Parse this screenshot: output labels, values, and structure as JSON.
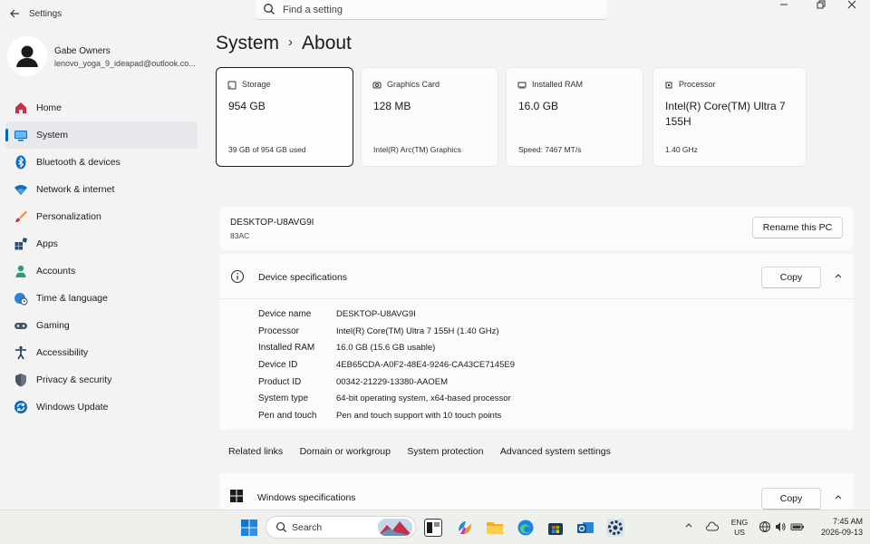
{
  "window": {
    "title": "Settings"
  },
  "search": {
    "placeholder": "Find a setting"
  },
  "user": {
    "name": "Gabe Owners",
    "email": "lenovo_yoga_9_ideapad@outlook.co..."
  },
  "sidebar": {
    "items": [
      {
        "label": "Home",
        "icon": "home-icon"
      },
      {
        "label": "System",
        "icon": "monitor-icon",
        "active": true
      },
      {
        "label": "Bluetooth & devices",
        "icon": "bluetooth-icon"
      },
      {
        "label": "Network & internet",
        "icon": "wifi-icon"
      },
      {
        "label": "Personalization",
        "icon": "brush-icon"
      },
      {
        "label": "Apps",
        "icon": "apps-icon"
      },
      {
        "label": "Accounts",
        "icon": "person-icon"
      },
      {
        "label": "Time & language",
        "icon": "globe-clock-icon"
      },
      {
        "label": "Gaming",
        "icon": "gamepad-icon"
      },
      {
        "label": "Accessibility",
        "icon": "accessibility-icon"
      },
      {
        "label": "Privacy & security",
        "icon": "shield-icon"
      },
      {
        "label": "Windows Update",
        "icon": "update-icon"
      }
    ]
  },
  "breadcrumb": {
    "parent": "System",
    "separator": "›",
    "current": "About"
  },
  "cards": [
    {
      "title": "Storage",
      "value": "954 GB",
      "sub": "39 GB of 954 GB used"
    },
    {
      "title": "Graphics Card",
      "value": "128 MB",
      "sub": "Intel(R) Arc(TM) Graphics"
    },
    {
      "title": "Installed RAM",
      "value": "16.0 GB",
      "sub": "Speed: 7467 MT/s"
    },
    {
      "title": "Processor",
      "value": "Intel(R) Core(TM) Ultra 7 155H",
      "sub": "1.40 GHz"
    }
  ],
  "pc": {
    "name": "DESKTOP-U8AVG9I",
    "model": "83AC",
    "rename_label": "Rename this PC"
  },
  "device_specs": {
    "title": "Device specifications",
    "copy_label": "Copy",
    "rows": [
      {
        "key": "Device name",
        "value": "DESKTOP-U8AVG9I"
      },
      {
        "key": "Processor",
        "value": "Intel(R) Core(TM) Ultra 7 155H (1.40 GHz)"
      },
      {
        "key": "Installed RAM",
        "value": "16.0 GB (15.6 GB usable)"
      },
      {
        "key": "Device ID",
        "value": "4EB65CDA-A0F2-48E4-9246-CA43CE7145E9"
      },
      {
        "key": "Product ID",
        "value": "00342-21229-13380-AAOEM"
      },
      {
        "key": "System type",
        "value": "64-bit operating system, x64-based processor"
      },
      {
        "key": "Pen and touch",
        "value": "Pen and touch support with 10 touch points"
      }
    ]
  },
  "related_links": {
    "title": "Related links",
    "links": [
      "Domain or workgroup",
      "System protection",
      "Advanced system settings"
    ]
  },
  "windows_specs": {
    "title": "Windows specifications",
    "copy_label": "Copy"
  },
  "taskbar": {
    "search_label": "Search",
    "lang_top": "ENG",
    "lang_bottom": "US",
    "time": "7:45 AM",
    "date": "2026-09-13"
  },
  "colors": {
    "accent": "#0067c0",
    "background": "#f3f3f3",
    "card": "#fbfbfb"
  }
}
